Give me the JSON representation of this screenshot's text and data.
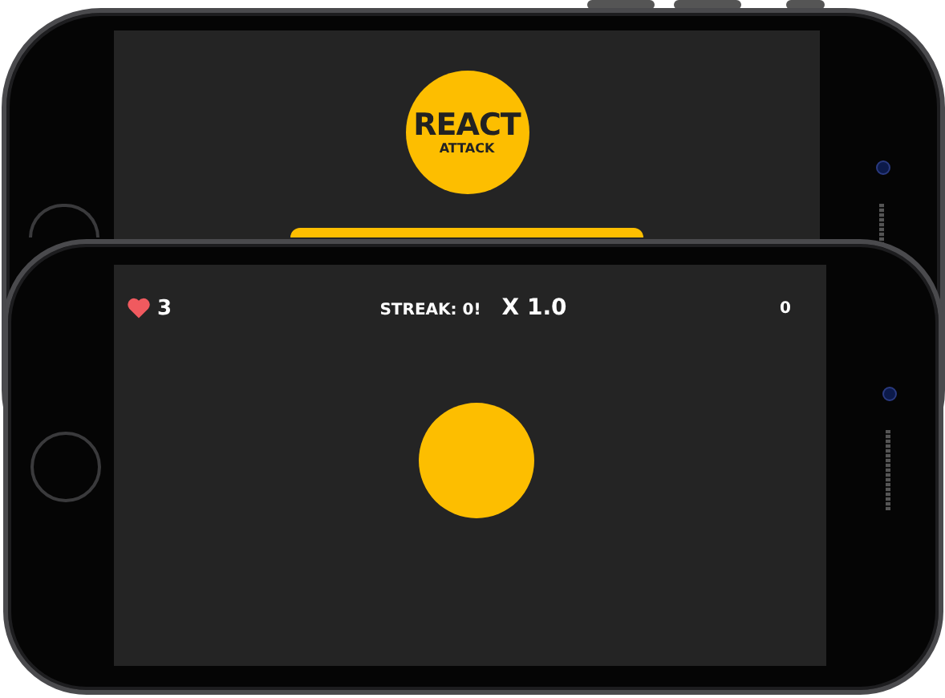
{
  "back_phone": {
    "logo": {
      "title": "REACT",
      "subtitle": "ATTACK"
    }
  },
  "front_phone": {
    "hud": {
      "lives": "3",
      "streak": "STREAK: 0!",
      "multiplier": "X 1.0",
      "score": "0"
    }
  }
}
